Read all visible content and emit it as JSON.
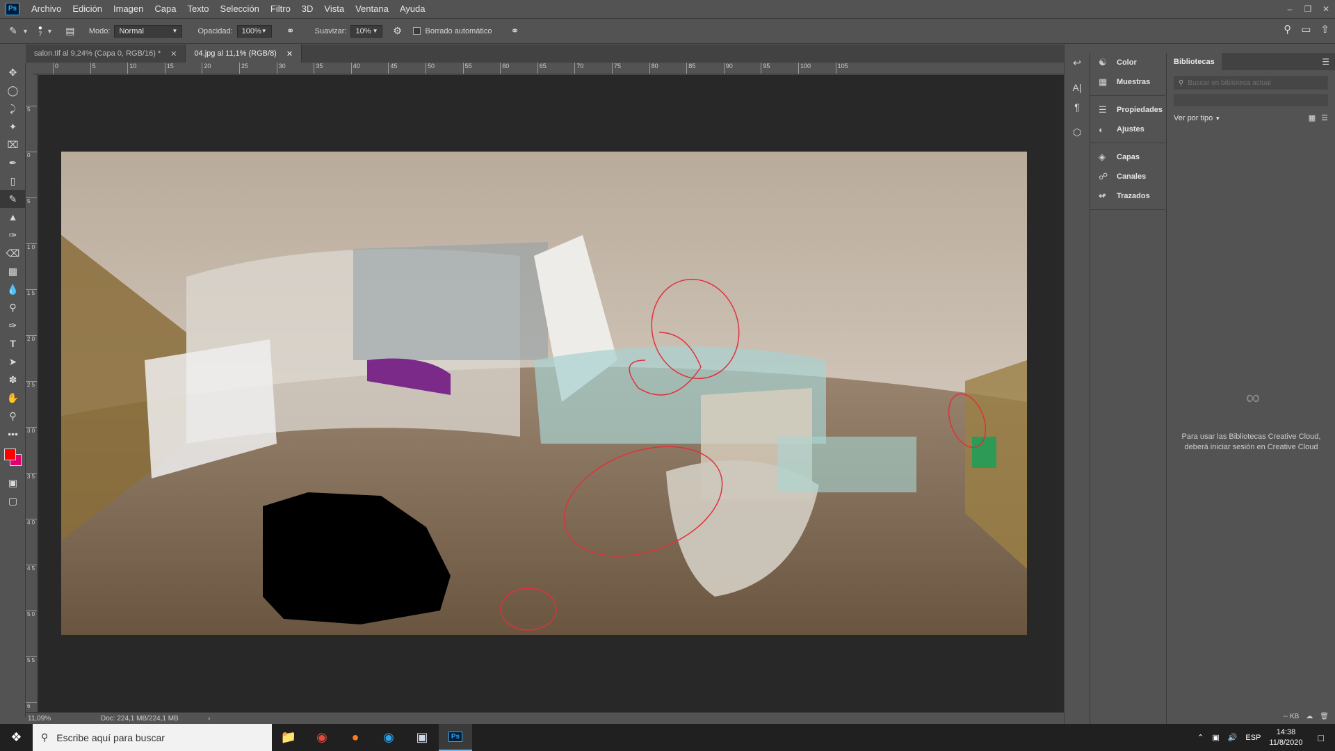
{
  "app": {
    "logo": "Ps"
  },
  "menu": [
    "Archivo",
    "Edición",
    "Imagen",
    "Capa",
    "Texto",
    "Selección",
    "Filtro",
    "3D",
    "Vista",
    "Ventana",
    "Ayuda"
  ],
  "options": {
    "brush_size": "7",
    "mode_label": "Modo:",
    "mode_value": "Normal",
    "opacity_label": "Opacidad:",
    "opacity_value": "100%",
    "smooth_label": "Suavizar:",
    "smooth_value": "10%",
    "auto_erase_label": "Borrado automático"
  },
  "tabs": [
    {
      "label": "salon.tif al 9,24% (Capa 0, RGB/16) *",
      "active": false
    },
    {
      "label": "04.jpg al 11,1% (RGB/8)",
      "active": true
    }
  ],
  "ruler_top": [
    "0",
    "5",
    "10",
    "15",
    "20",
    "25",
    "30",
    "35",
    "40",
    "45",
    "50",
    "55",
    "60",
    "65",
    "70",
    "75",
    "80",
    "85",
    "90",
    "95",
    "100",
    "105"
  ],
  "ruler_left": [
    "5",
    "0",
    "5",
    "1 0",
    "1 5",
    "2 0",
    "2 5",
    "3 0",
    "3 5",
    "4 0",
    "4 5",
    "5 0",
    "5 5",
    "6"
  ],
  "status": {
    "zoom": "11,09%",
    "doc": "Doc: 224,1 MB/224,1 MB"
  },
  "panels": [
    {
      "label": "Color",
      "icon": "color-icon"
    },
    {
      "label": "Muestras",
      "icon": "swatches-icon"
    },
    {
      "label": "Propiedades",
      "icon": "properties-icon"
    },
    {
      "label": "Ajustes",
      "icon": "adjustments-icon"
    },
    {
      "label": "Capas",
      "icon": "layers-icon"
    },
    {
      "label": "Canales",
      "icon": "channels-icon"
    },
    {
      "label": "Trazados",
      "icon": "paths-icon"
    }
  ],
  "libraries": {
    "tab": "Bibliotecas",
    "search_placeholder": "Buscar en biblioteca actual",
    "view_by": "Ver por tipo",
    "message": "Para usar las Bibliotecas Creative Cloud, deberá iniciar sesión en Creative Cloud",
    "size": "-- KB"
  },
  "taskbar": {
    "search_placeholder": "Escribe aquí para buscar",
    "lang": "ESP",
    "time": "14:38",
    "date": "11/8/2020"
  },
  "colors": {
    "foreground": "#ff0000",
    "background": "#e0006f",
    "annotation": "#e0303c"
  }
}
